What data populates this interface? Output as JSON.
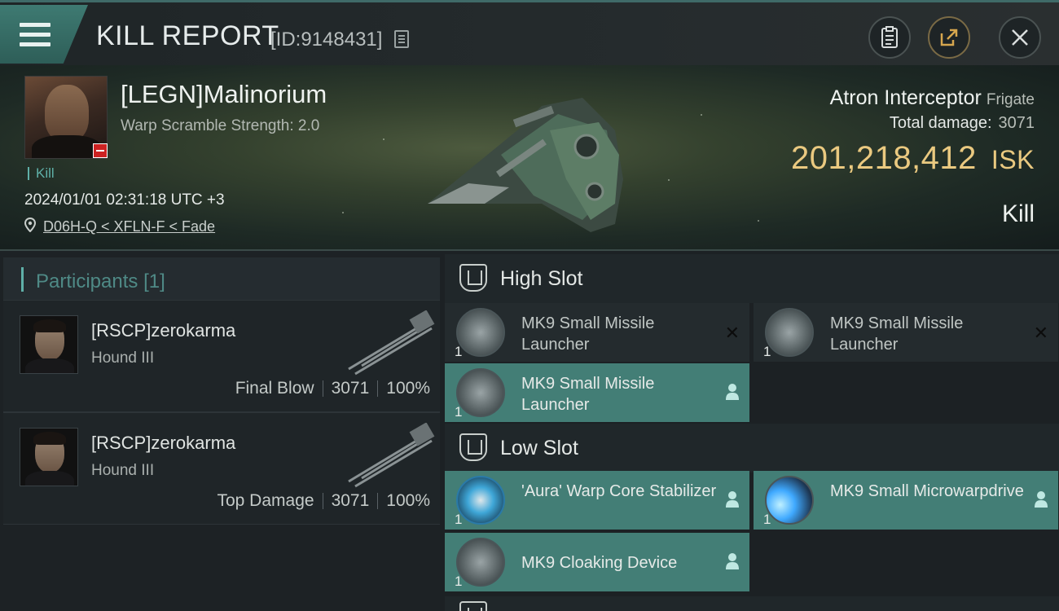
{
  "header": {
    "title": "KILL REPORT",
    "kill_id": "[ID:9148431]"
  },
  "victim": {
    "name": "[LEGN]Malinorium",
    "warp_scramble": "Warp Scramble Strength: 2.0",
    "result_tag": "Kill",
    "datetime": "2024/01/01 02:31:18 UTC +3",
    "location": "D06H-Q < XFLN-F < Fade",
    "ship": "Atron Interceptor",
    "ship_class": "Frigate",
    "total_damage_label": "Total damage:",
    "total_damage": "3071",
    "isk_value": "201,218,412",
    "isk_unit": "ISK",
    "outcome": "Kill"
  },
  "participants": {
    "title": "Participants",
    "count": "[1]",
    "rows": [
      {
        "name": "[RSCP]zerokarma",
        "ship": "Hound III",
        "role": "Final Blow",
        "damage": "3071",
        "percent": "100%"
      },
      {
        "name": "[RSCP]zerokarma",
        "ship": "Hound III",
        "role": "Top Damage",
        "damage": "3071",
        "percent": "100%"
      }
    ]
  },
  "fittings": {
    "high_slot": {
      "title": "High Slot",
      "modules": [
        {
          "name": "MK9 Small Missile Launcher",
          "qty": "1",
          "state": "destroyed",
          "icon": "missile-launcher-icon"
        },
        {
          "name": "MK9 Small Missile Launcher",
          "qty": "1",
          "state": "destroyed",
          "icon": "missile-launcher-icon"
        },
        {
          "name": "MK9 Small Missile Launcher",
          "qty": "1",
          "state": "dropped",
          "icon": "missile-launcher-icon"
        }
      ]
    },
    "low_slot": {
      "title": "Low Slot",
      "modules": [
        {
          "name": "'Aura' Warp Core Stabilizer",
          "qty": "1",
          "state": "dropped",
          "icon": "warp-core-stabilizer-icon"
        },
        {
          "name": "MK9 Small Microwarpdrive",
          "qty": "1",
          "state": "dropped",
          "icon": "microwarpdrive-icon"
        },
        {
          "name": "MK9 Cloaking Device",
          "qty": "1",
          "state": "dropped",
          "icon": "cloaking-device-icon"
        }
      ]
    }
  },
  "colors": {
    "accent_teal": "#437e76",
    "isk_gold": "#eac980",
    "share_accent": "#d6a64e"
  }
}
